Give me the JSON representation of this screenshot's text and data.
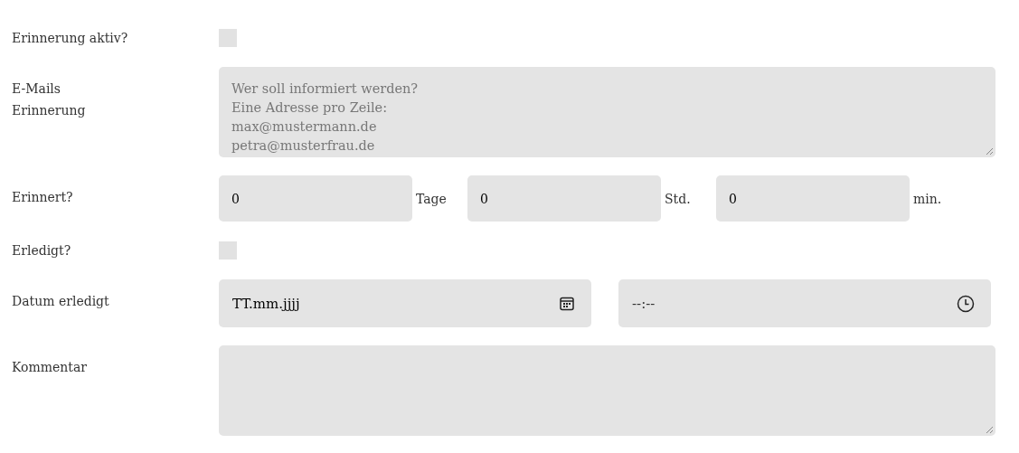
{
  "fields": [
    {
      "kind": "checkbox",
      "label": "Erinnerung aktiv?",
      "checked": false
    },
    {
      "kind": "textarea",
      "label": "E-Mails\nErinnerung",
      "placeholder": "Wer soll informiert werden?\nEine Adresse pro Zeile:\nmax@mustermann.de\npetra@musterfrau.de"
    },
    {
      "kind": "interval",
      "label": "Erinnert?",
      "parts": [
        {
          "value": "0",
          "unit": "Tage"
        },
        {
          "value": "0",
          "unit": "Std."
        },
        {
          "value": "0",
          "unit": "min."
        }
      ]
    },
    {
      "kind": "checkbox",
      "label": "Erledigt?",
      "checked": false
    },
    {
      "kind": "datetime",
      "label": "Datum erledigt",
      "date_placeholder": "TT.mm.jjjj",
      "time_placeholder": "--:--"
    },
    {
      "kind": "textarea",
      "label": "Kommentar"
    }
  ]
}
